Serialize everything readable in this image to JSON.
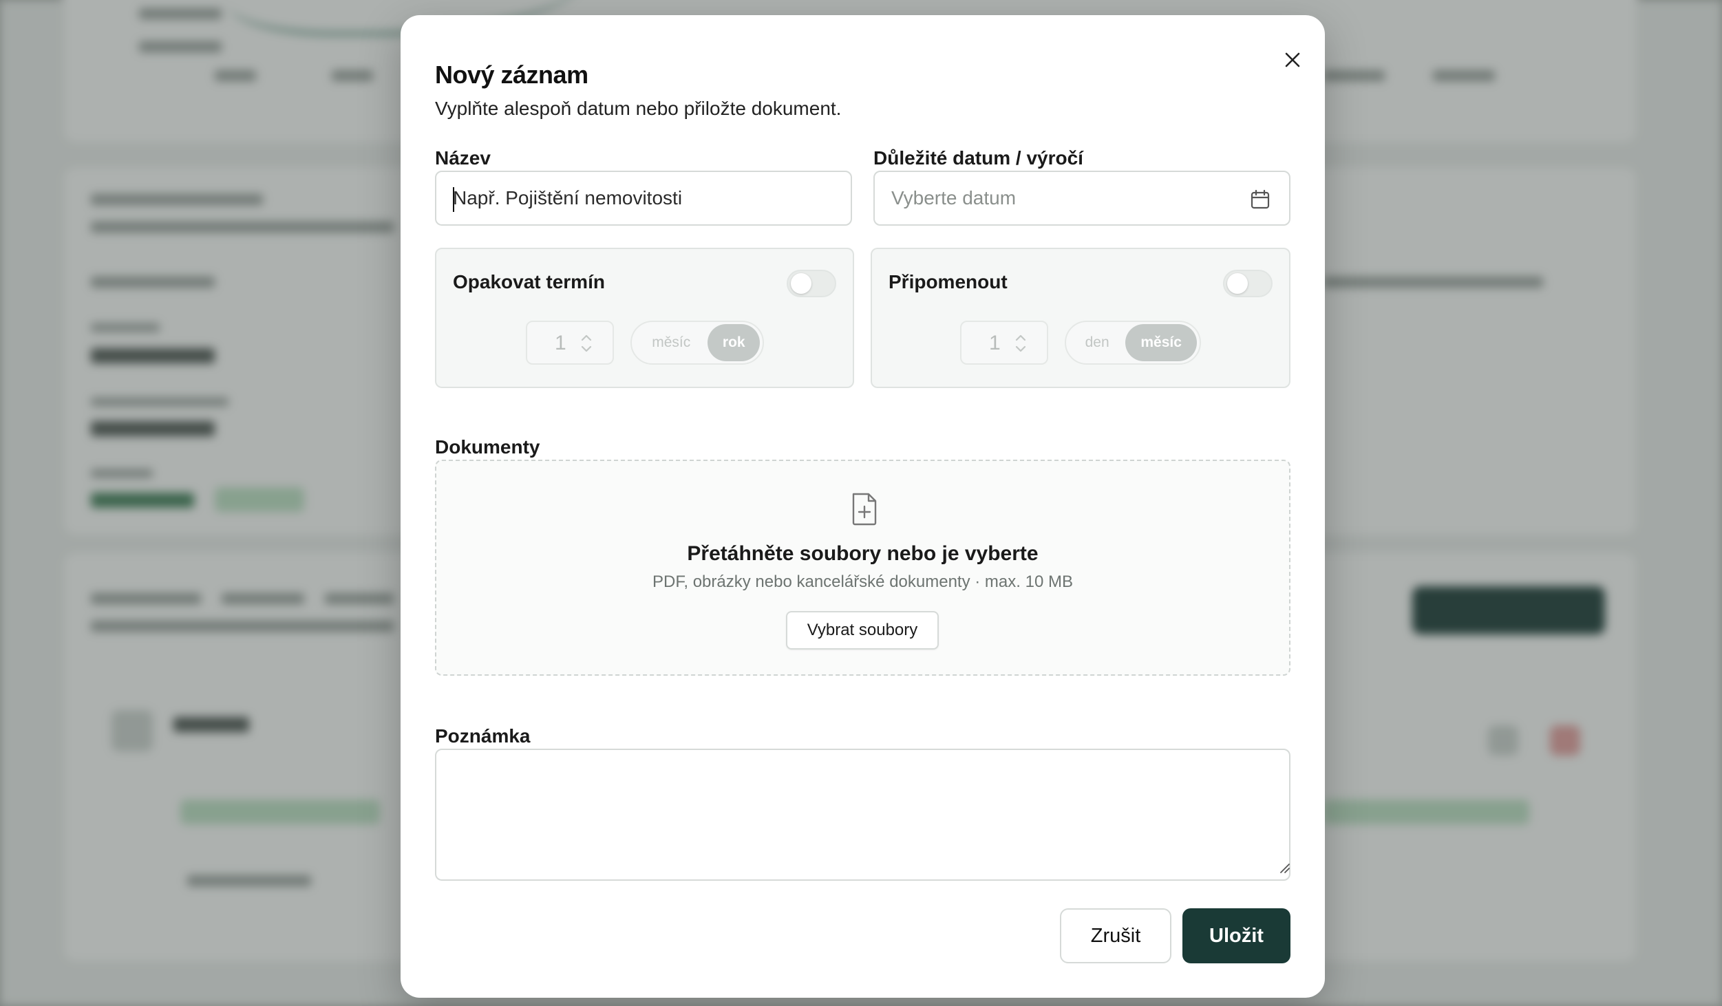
{
  "modal": {
    "title": "Nový záznam",
    "subtitle": "Vyplňte alespoň datum nebo přiložte dokument.",
    "close_icon": "close-icon"
  },
  "form": {
    "name_label": "Název",
    "name_placeholder": "Např. Pojištění nemovitosti",
    "date_label": "Důležité datum / výročí",
    "date_placeholder": "Vyberte datum",
    "repeat": {
      "label": "Opakovat termín",
      "enabled": false,
      "count": "1",
      "options": [
        "měsíc",
        "rok"
      ],
      "selected": "rok"
    },
    "remind": {
      "label": "Připomenout",
      "enabled": false,
      "count": "1",
      "options": [
        "den",
        "měsíc"
      ],
      "selected": "měsíc"
    },
    "documents_label": "Dokumenty",
    "dropzone": {
      "title": "Přetáhněte soubory nebo je vyberte",
      "hint": "PDF, obrázky nebo kancelářské dokumenty · max. 10 MB",
      "button": "Vybrat soubory",
      "icon": "file-plus-icon"
    },
    "note_label": "Poznámka",
    "note_value": ""
  },
  "actions": {
    "cancel": "Zrušit",
    "save": "Uložit"
  },
  "colors": {
    "primary": "#1a3a36",
    "overlay": "#6b716e",
    "panel_bg": "#f5f7f6"
  }
}
